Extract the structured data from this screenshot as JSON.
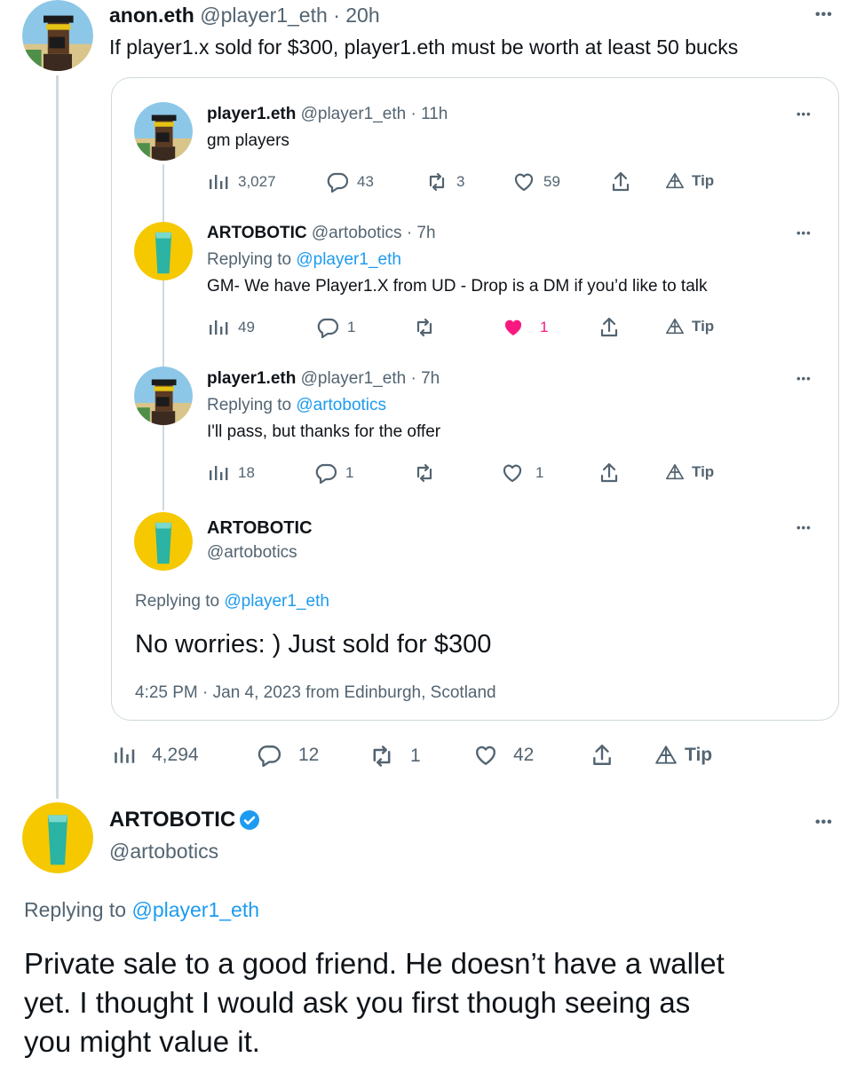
{
  "top_tweet": {
    "name": "anon.eth",
    "handle": "@player1_eth",
    "time": "· 20h",
    "text": "If player1.x sold for $300, player1.eth must be worth at least 50 bucks",
    "stats": {
      "views": "4,294",
      "replies": "12",
      "retweets": "1",
      "likes": "42",
      "tip": "Tip"
    }
  },
  "quoted": {
    "t1": {
      "name": "player1.eth",
      "handle": "@player1_eth · 11h",
      "text": "gm players",
      "stats": {
        "views": "3,027",
        "replies": "43",
        "retweets": "3",
        "likes": "59",
        "tip": "Tip"
      }
    },
    "t2": {
      "name": "ARTOBOTIC",
      "handle": "@artobotics · 7h",
      "replying_prefix": "Replying to ",
      "replying_to": "@player1_eth",
      "text": "GM- We have Player1.X from UD - Drop is a DM if you’d like to talk",
      "stats": {
        "views": "49",
        "replies": "1",
        "retweets": "",
        "likes": "1",
        "tip": "Tip"
      }
    },
    "t3": {
      "name": "player1.eth",
      "handle": "@player1_eth · 7h",
      "replying_prefix": "Replying to ",
      "replying_to": "@artobotics",
      "text": "I'll pass, but thanks for the offer",
      "stats": {
        "views": "18",
        "replies": "1",
        "retweets": "",
        "likes": "1",
        "tip": "Tip"
      }
    },
    "t4": {
      "name": "ARTOBOTIC",
      "handle": "@artobotics",
      "replying_prefix": "Replying to ",
      "replying_to": "@player1_eth",
      "text": "No worries: ) Just sold for $300",
      "timestamp": "4:25 PM · Jan 4, 2023 from Edinburgh, Scotland"
    }
  },
  "bottom_tweet": {
    "name": "ARTOBOTIC",
    "handle": "@artobotics",
    "replying_prefix": "Replying to ",
    "replying_to": "@player1_eth",
    "text_line1": "Private sale to a good friend. He doesn’t have a wallet",
    "text_line2": "yet. I thought I would ask you first though seeing as",
    "text_line3": "you might value it."
  },
  "colors": {
    "accent": "#1d9bf0",
    "like": "#f91880",
    "muted": "#536471",
    "avatar_yellow": "#f5c800",
    "avatar_teal": "#2bb3a3"
  },
  "avatar_art_label": "ART",
  "more_icon": "•••"
}
